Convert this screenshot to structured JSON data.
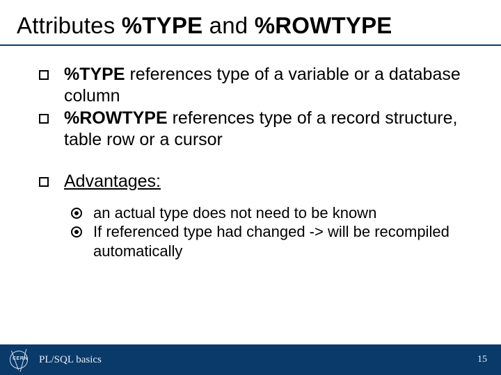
{
  "title": {
    "pre": "Attributes ",
    "b1": "%TYPE",
    "mid": " and ",
    "b2": "%ROWTYPE"
  },
  "bullets": {
    "b1_strong": "%TYPE",
    "b1_rest": " references type of a variable or a database column",
    "b2_strong": "%ROWTYPE",
    "b2_rest": " references type of a record structure, table row or a cursor",
    "adv_label": "Advantages:"
  },
  "sub": {
    "s1": "an actual type does not need to be known",
    "s2": "If referenced type had changed -> will be recompiled automatically"
  },
  "footer": {
    "logo_text": "CERN",
    "title": "PL/SQL basics",
    "page": "15"
  }
}
